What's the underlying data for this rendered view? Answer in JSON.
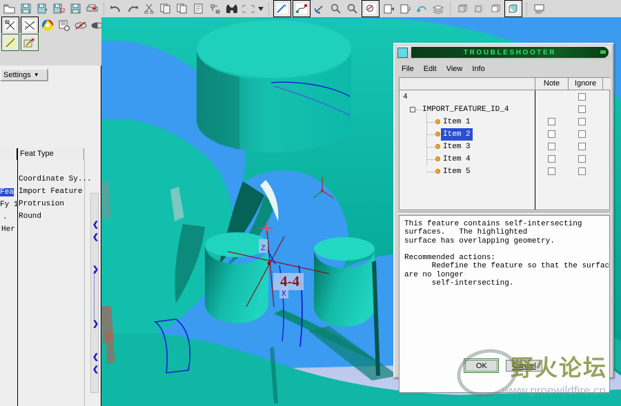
{
  "app": {
    "background_color": "#d6d6d6",
    "viewport_bg": "#3a9bf0",
    "model_color": "#00b9a2"
  },
  "toolbars": {
    "row1": [
      {
        "name": "open-icon",
        "glyph": "open"
      },
      {
        "name": "save-icon",
        "glyph": "save"
      },
      {
        "name": "save-as-icon",
        "glyph": "save-as"
      },
      {
        "name": "save-a-copy-icon",
        "glyph": "save-copy"
      },
      {
        "name": "backup-icon",
        "glyph": "backup"
      },
      {
        "name": "print-icon",
        "glyph": "print"
      },
      {
        "name": "separator",
        "glyph": "sep"
      },
      {
        "name": "undo-icon",
        "glyph": "undo"
      },
      {
        "name": "redo-icon",
        "glyph": "redo"
      },
      {
        "name": "cut-icon",
        "glyph": "cut"
      },
      {
        "name": "copy-icon",
        "glyph": "copy"
      },
      {
        "name": "paste-icon",
        "glyph": "paste"
      },
      {
        "name": "paste-special-icon",
        "glyph": "paste-special"
      },
      {
        "name": "regenerate-icon",
        "glyph": "regen"
      },
      {
        "name": "find-icon",
        "glyph": "binoculars"
      },
      {
        "name": "select-box-icon",
        "glyph": "selbox"
      },
      {
        "name": "select-dropdown-caret",
        "glyph": "caret"
      },
      {
        "name": "separator",
        "glyph": "sep"
      },
      {
        "name": "sketch-icon",
        "glyph": "sketch"
      },
      {
        "name": "datum-curve-icon",
        "glyph": "curve"
      },
      {
        "name": "rotate-icon",
        "glyph": "rotate"
      },
      {
        "name": "zoom-in-icon",
        "glyph": "zoom-in"
      },
      {
        "name": "zoom-out-icon",
        "glyph": "zoom-out"
      },
      {
        "name": "refit-icon",
        "glyph": "refit"
      },
      {
        "name": "repaint-icon",
        "glyph": "repaint"
      },
      {
        "name": "layer-icon",
        "glyph": "layer"
      },
      {
        "name": "appearance-icon",
        "glyph": "appearance"
      },
      {
        "name": "stack-icon",
        "glyph": "stack"
      },
      {
        "name": "separator",
        "glyph": "sep"
      },
      {
        "name": "wireframe-icon",
        "glyph": "wire"
      },
      {
        "name": "hidden-line-icon",
        "glyph": "hidden"
      },
      {
        "name": "no-hidden-icon",
        "glyph": "nohidden"
      },
      {
        "name": "shading-icon",
        "glyph": "shade"
      },
      {
        "name": "separator",
        "glyph": "sep"
      },
      {
        "name": "view-manager-icon",
        "glyph": "viewmgr"
      }
    ],
    "row2": [
      {
        "name": "new-drawing-icon",
        "glyph": "newdraw"
      },
      {
        "name": "sketch-view-icon",
        "glyph": "sketchview"
      },
      {
        "name": "color-appearance-icon",
        "glyph": "colorwheel"
      },
      {
        "name": "model-player-icon",
        "glyph": "player"
      },
      {
        "name": "datum-plane-off-icon",
        "glyph": "plane-off"
      },
      {
        "name": "datum-axis-icon",
        "glyph": "axis"
      },
      {
        "name": "datum-point-icon",
        "glyph": "point"
      },
      {
        "name": "relations-icon",
        "glyph": "relations"
      },
      {
        "name": "save-view-icon",
        "glyph": "saveview"
      },
      {
        "name": "refresh-view-icon",
        "glyph": "refreshview"
      },
      {
        "name": "surface-icon",
        "glyph": "surface"
      },
      {
        "name": "note-icon",
        "glyph": "note"
      },
      {
        "name": "annotate-icon",
        "glyph": "annotate"
      },
      {
        "name": "dimension-icon",
        "glyph": "dim"
      }
    ],
    "row3": [
      {
        "name": "tool-a-icon",
        "glyph": "tool-a"
      },
      {
        "name": "tool-b-icon",
        "glyph": "tool-b"
      }
    ]
  },
  "left_panel": {
    "settings_button": "Settings",
    "settings_caret": "▼",
    "column_header": "Feat Type",
    "clipped_first_column": [
      "Fea",
      "Fy 1",
      ".",
      "Her"
    ],
    "feat_types": [
      "Coordinate Sy...",
      "Import Feature",
      "Protrusion",
      "Round"
    ],
    "selected_first_column_index": 0,
    "splitter_arrows": [
      "❮",
      "❮",
      "❯",
      "❯",
      "❮",
      "❮"
    ]
  },
  "viewport": {
    "annotation_label": "4-4",
    "annotation_color": "#8b0f14",
    "csys_axis_labels": [
      "Z",
      "X"
    ]
  },
  "dialog": {
    "title": "TROUBLESHOOTER",
    "title_color": "#33e26a",
    "menu": [
      "File",
      "Edit",
      "View",
      "Info"
    ],
    "columns": [
      "",
      "Note",
      "Ignore",
      ""
    ],
    "tree": [
      {
        "label": "4",
        "indent": 0,
        "kind": "root-number",
        "note": false,
        "ignore": true,
        "selected": false
      },
      {
        "label": "IMPORT_FEATURE_ID_4",
        "indent": 1,
        "kind": "expander",
        "note": false,
        "ignore": true,
        "selected": false
      },
      {
        "label": "Item 1",
        "indent": 2,
        "kind": "bullet",
        "note": true,
        "ignore": true,
        "selected": false
      },
      {
        "label": "Item 2",
        "indent": 2,
        "kind": "bullet",
        "note": true,
        "ignore": true,
        "selected": true
      },
      {
        "label": "Item 3",
        "indent": 2,
        "kind": "bullet",
        "note": true,
        "ignore": true,
        "selected": false
      },
      {
        "label": "Item 4",
        "indent": 2,
        "kind": "bullet",
        "note": true,
        "ignore": true,
        "selected": false
      },
      {
        "label": "Item 5",
        "indent": 2,
        "kind": "bullet",
        "note": true,
        "ignore": true,
        "selected": false
      }
    ],
    "message": "This feature contains self-intersecting\nsurfaces.   The highlighted\nsurface has overlapping geometry.\n\nRecommended actions:\n      Redefine the feature so that the surfaces\nare no longer\n      self-intersecting.",
    "ok_label": "OK",
    "cancel_label": "Cancel"
  },
  "watermark": {
    "chinese": "野火论坛",
    "url": "www.proewildfire.cn"
  }
}
